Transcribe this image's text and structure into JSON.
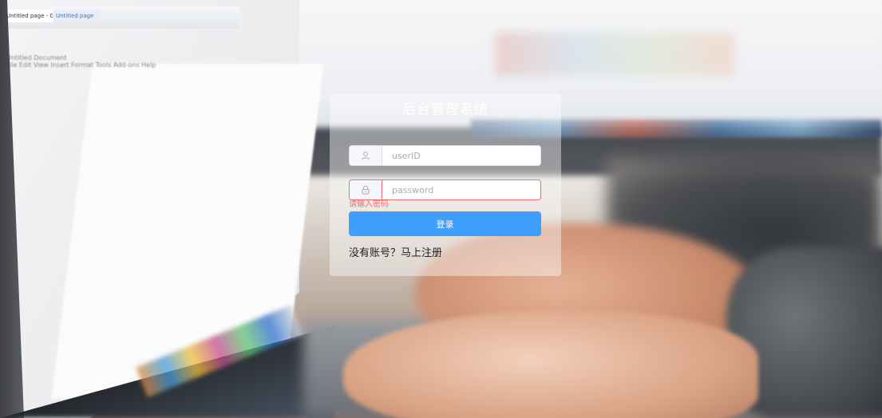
{
  "app": {
    "title": "后台管理系统"
  },
  "background": {
    "laptop_tab_1": "Untitled page - Google Docs",
    "laptop_tab_2": "Untitled page",
    "laptop_doc_title": "Untitled Document",
    "laptop_menu": "File  Edit  View  Insert  Format  Tools  Add-ons  Help"
  },
  "login_form": {
    "username": {
      "placeholder": "userID",
      "value": "",
      "icon": "user-icon"
    },
    "password": {
      "placeholder": "password",
      "value": "",
      "icon": "lock-icon",
      "error": "请输入密码"
    },
    "submit_label": "登录",
    "register_link": "没有账号？马上注册"
  },
  "colors": {
    "primary": "#409eff",
    "error": "#f56c6c",
    "panel_bg": "rgba(255,255,255,0.42)"
  }
}
